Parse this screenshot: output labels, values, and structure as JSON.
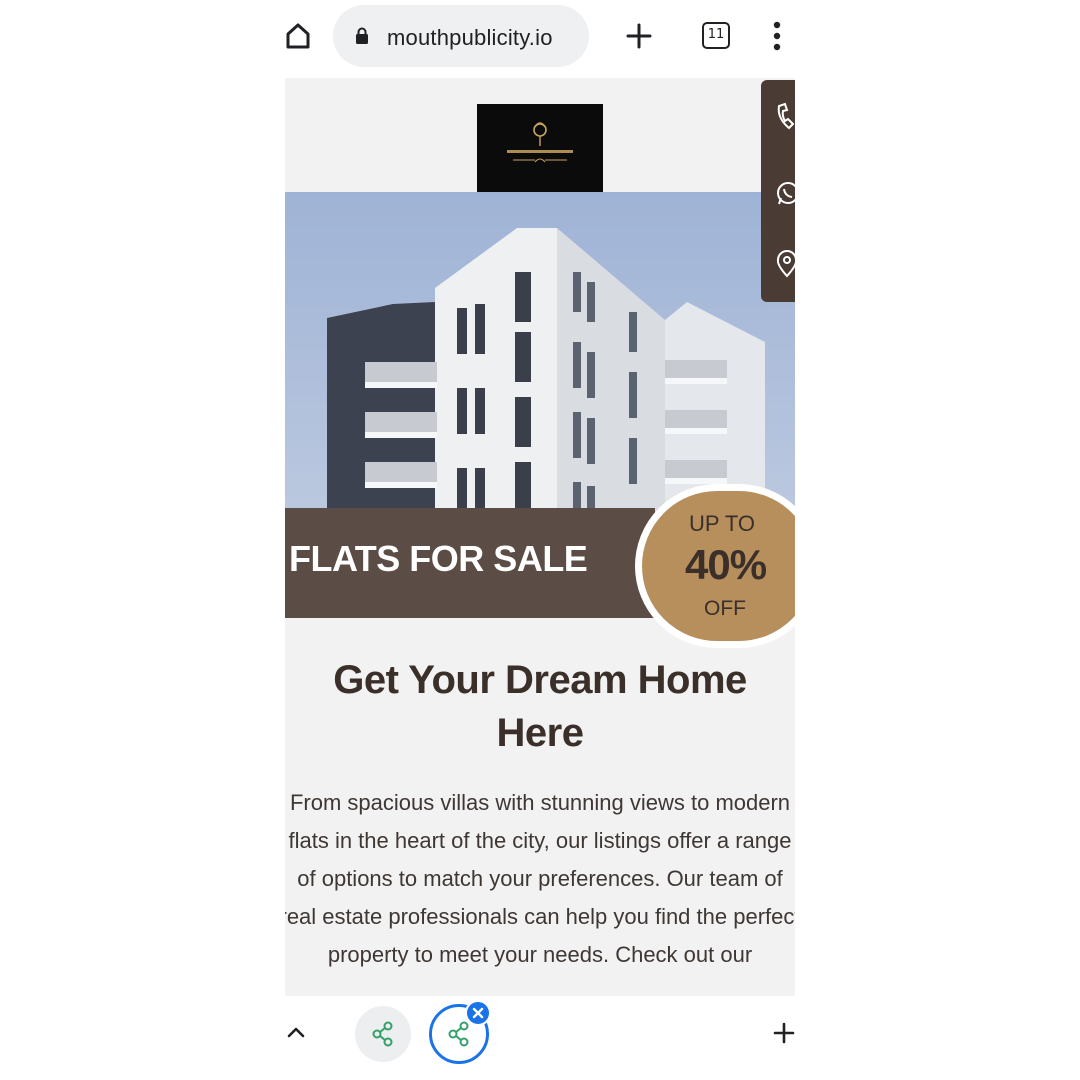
{
  "browser": {
    "url": "mouthpublicity.io",
    "tab_count": "11"
  },
  "icons": {
    "home": "home-icon",
    "lock": "lock-icon",
    "new_tab": "plus-icon",
    "tabs": "tab-switcher-icon",
    "menu": "more-vert-icon",
    "phone": "phone-icon",
    "whatsapp": "whatsapp-icon",
    "location": "location-pin-icon",
    "chevron": "chevron-up-icon",
    "share": "share-icon",
    "close": "close-icon"
  },
  "page": {
    "banner": "FLATS FOR SALE",
    "discount": {
      "prefix": "UP TO",
      "value": "40%",
      "suffix": "OFF"
    },
    "heading": "Get Your Dream Home Here",
    "paragraph": "From spacious villas with stunning views to modern flats in the heart of the city, our listings offer a range of options to match your preferences. Our team of real estate professionals can help you find the perfect property to meet your needs. Check out our"
  },
  "colors": {
    "brand_brown": "#5b4d45",
    "accent_gold": "#b68f5d",
    "heading_text": "#3b2f2a",
    "chrome_blue": "#1a73e8"
  }
}
